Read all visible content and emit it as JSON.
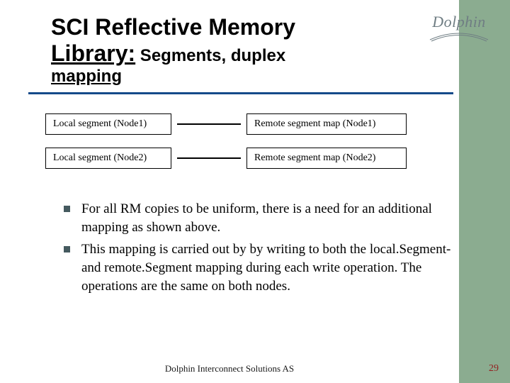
{
  "brand": {
    "name": "Dolphin"
  },
  "title": {
    "line1": "SCI Reflective Memory",
    "line2_underlined": "Library:",
    "line2_rest": " Segments, duplex",
    "line3": "mapping"
  },
  "diagram": {
    "rows": [
      {
        "left": "Local segment (Node1)",
        "right": "Remote segment map (Node1)"
      },
      {
        "left": "Local segment (Node2)",
        "right": "Remote segment map (Node2)"
      }
    ]
  },
  "bullets": [
    "For all RM copies to be uniform, there is a need for an additional mapping as shown above.",
    "This mapping is carried out by by writing to both the local.Segment- and remote.Segment mapping during each write operation. The operations are the same on both nodes."
  ],
  "footer": "Dolphin Interconnect Solutions AS",
  "page_number": "29"
}
